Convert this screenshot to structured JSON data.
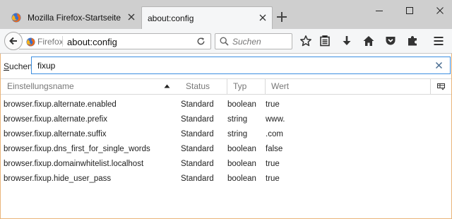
{
  "colors": {
    "tabstrip_bg": "#cfcfcf",
    "toolbar_bg": "#f5f6f7",
    "filter_focus_border": "#3c8ee0",
    "content_border": "#e9b47a"
  },
  "tabs": [
    {
      "title": "Mozilla Firefox-Startseite",
      "icon": "firefox-icon",
      "active": false
    },
    {
      "title": "about:config",
      "icon": null,
      "active": true
    }
  ],
  "navbar": {
    "identity_label": "Firefox",
    "url": "about:config",
    "search_placeholder": "Suchen",
    "icons": [
      "back-icon",
      "reload-icon",
      "search-icon",
      "bookmark-star-icon",
      "reading-list-icon",
      "download-icon",
      "home-icon",
      "pocket-icon",
      "extension-icon",
      "menu-icon"
    ]
  },
  "filter": {
    "label_access_key": "S",
    "label_rest": "uchen:",
    "value": "fixup"
  },
  "columns": {
    "name": "Einstellungsname",
    "status": "Status",
    "type": "Typ",
    "value": "Wert",
    "sort": "name-ascending"
  },
  "prefs": [
    {
      "name": "browser.fixup.alternate.enabled",
      "status": "Standard",
      "type": "boolean",
      "value": "true"
    },
    {
      "name": "browser.fixup.alternate.prefix",
      "status": "Standard",
      "type": "string",
      "value": "www."
    },
    {
      "name": "browser.fixup.alternate.suffix",
      "status": "Standard",
      "type": "string",
      "value": ".com"
    },
    {
      "name": "browser.fixup.dns_first_for_single_words",
      "status": "Standard",
      "type": "boolean",
      "value": "false"
    },
    {
      "name": "browser.fixup.domainwhitelist.localhost",
      "status": "Standard",
      "type": "boolean",
      "value": "true"
    },
    {
      "name": "browser.fixup.hide_user_pass",
      "status": "Standard",
      "type": "boolean",
      "value": "true"
    }
  ]
}
